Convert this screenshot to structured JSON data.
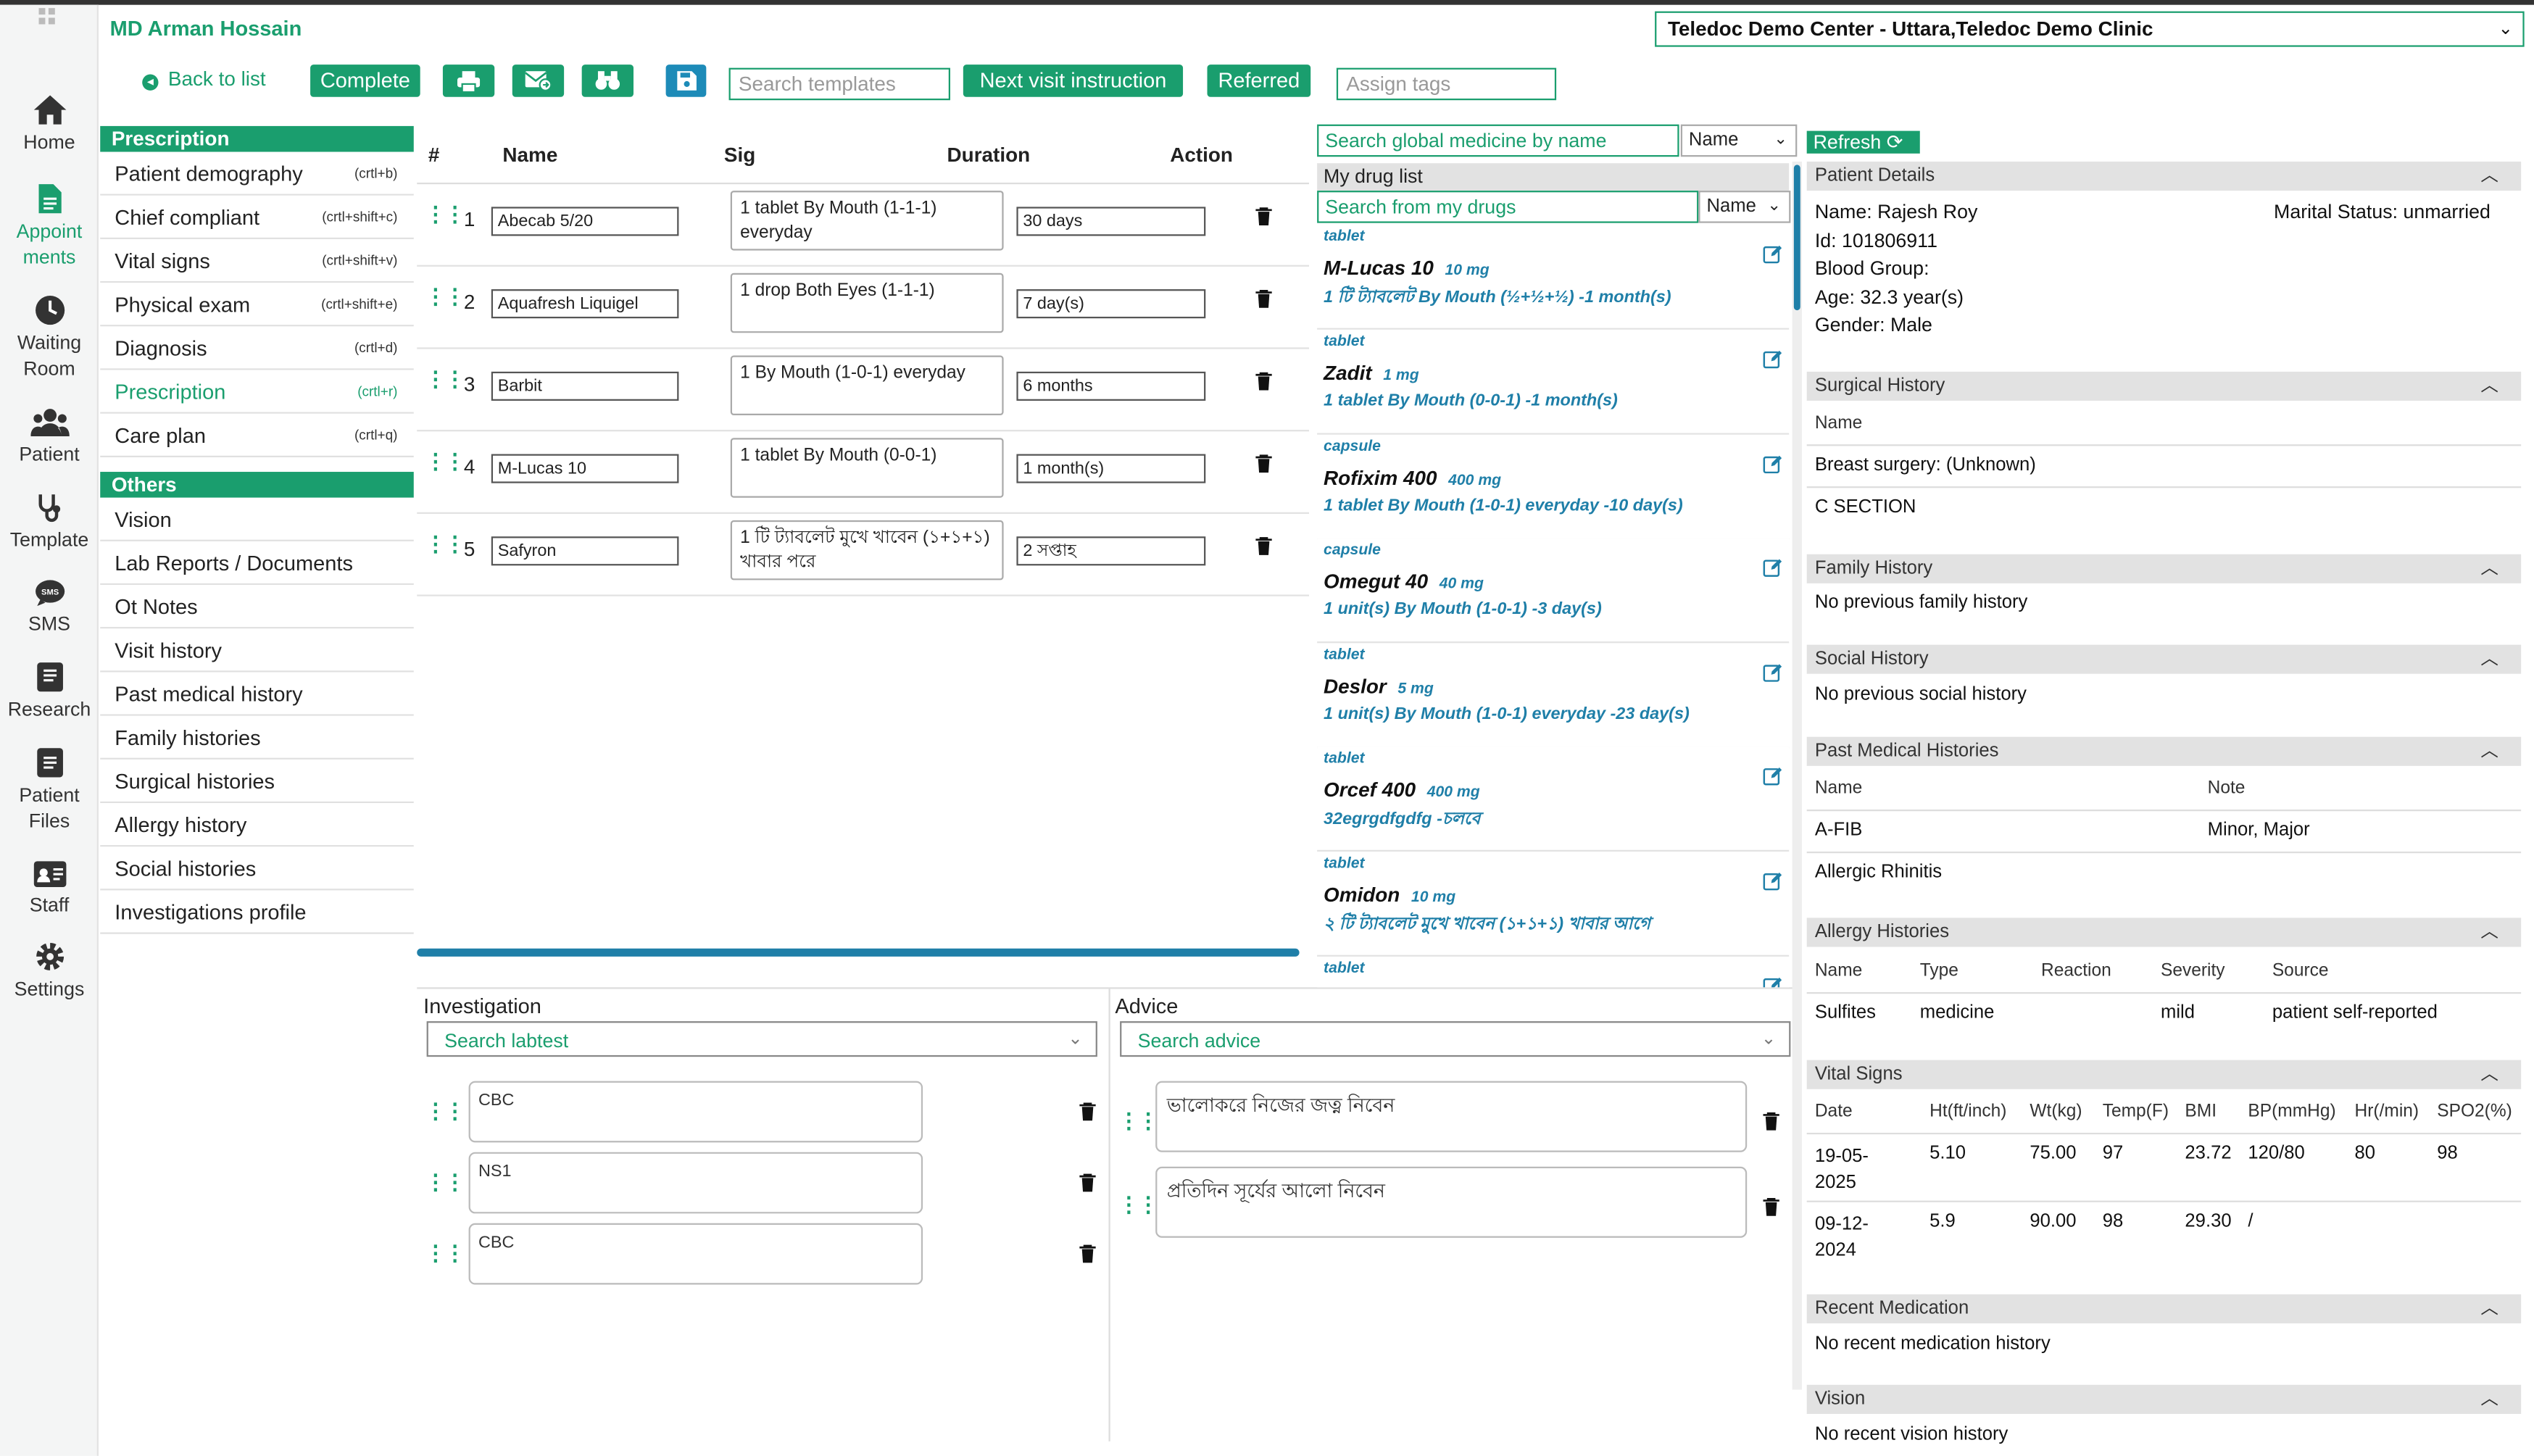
{
  "header": {
    "user_name": "MD Arman Hossain",
    "center": "Teledoc Demo Center - Uttara,Teledoc Demo Clinic"
  },
  "nav": {
    "home": "Home",
    "appointments_1": "Appoint",
    "appointments_2": "ments",
    "waiting_1": "Waiting",
    "waiting_2": "Room",
    "patient": "Patient",
    "template": "Template",
    "sms": "SMS",
    "research": "Research",
    "patient_files_1": "Patient",
    "patient_files_2": "Files",
    "staff": "Staff",
    "settings": "Settings"
  },
  "toolbar": {
    "back": "Back to list",
    "complete": "Complete",
    "search_templates_placeholder": "Search templates",
    "next_visit": "Next visit instruction",
    "referred": "Referred",
    "assign_tags_placeholder": "Assign tags"
  },
  "menu": {
    "prescription_head": "Prescription",
    "items": [
      {
        "label": "Patient demography",
        "shortcut": "(crtl+b)"
      },
      {
        "label": "Chief compliant",
        "shortcut": "(crtl+shift+c)"
      },
      {
        "label": "Vital signs",
        "shortcut": "(crtl+shift+v)"
      },
      {
        "label": "Physical exam",
        "shortcut": "(crtl+shift+e)"
      },
      {
        "label": "Diagnosis",
        "shortcut": "(crtl+d)"
      },
      {
        "label": "Prescription",
        "shortcut": "(crtl+r)"
      },
      {
        "label": "Care plan",
        "shortcut": "(crtl+q)"
      }
    ],
    "others_head": "Others",
    "others": [
      "Vision",
      "Lab Reports / Documents",
      "Ot Notes",
      "Visit history",
      "Past medical history",
      "Family histories",
      "Surgical histories",
      "Allergy history",
      "Social histories",
      "Investigations profile"
    ]
  },
  "rx_table": {
    "headers": {
      "num": "#",
      "name": "Name",
      "sig": "Sig",
      "duration": "Duration",
      "action": "Action"
    },
    "rows": [
      {
        "num": "1",
        "name": "Abecab 5/20",
        "sig": "1 tablet By Mouth (1-1-1) everyday",
        "duration": "30 days"
      },
      {
        "num": "2",
        "name": "Aquafresh Liquigel",
        "sig": "1 drop Both Eyes (1-1-1)",
        "duration": "7 day(s)"
      },
      {
        "num": "3",
        "name": "Barbit",
        "sig": "1  By Mouth (1-0-1) everyday",
        "duration": "6 months"
      },
      {
        "num": "4",
        "name": "M-Lucas 10",
        "sig": "1 tablet By Mouth (0-0-1)",
        "duration": "1 month(s)"
      },
      {
        "num": "5",
        "name": "Safyron",
        "sig": "1 টি ট্যাবলেট মুখে খাবেন (১+১+১) খাবার পরে",
        "duration": "2 সপ্তাহ"
      }
    ]
  },
  "investigation": {
    "label": "Investigation",
    "placeholder": "Search labtest",
    "items": [
      "CBC",
      "NS1",
      "CBC"
    ]
  },
  "advice": {
    "label": "Advice",
    "placeholder": "Search advice",
    "items": [
      "ভালোকরে নিজের জত্ন নিবেন",
      "প্রতিদিন সূর্যের আলো নিবেন"
    ]
  },
  "drug_list": {
    "global_search_placeholder": "Search global medicine by name",
    "sort": "Name",
    "title": "My drug list",
    "my_search_placeholder": "Search from my drugs",
    "drugs": [
      {
        "form": "tablet",
        "name": "M-Lucas 10",
        "strength": "10 mg",
        "sig": "1 টি ট্যাবলেট By Mouth (½+½+½) -1 month(s)"
      },
      {
        "form": "tablet",
        "name": "Zadit",
        "strength": "1 mg",
        "sig": "1 tablet By Mouth (0-0-1) -1 month(s)"
      },
      {
        "form": "capsule",
        "name": "Rofixim 400",
        "strength": "400 mg",
        "sig": "1 tablet By Mouth (1-0-1) everyday -10 day(s)"
      },
      {
        "form": "capsule",
        "name": "Omegut 40",
        "strength": "40 mg",
        "sig": "1 unit(s) By Mouth (1-0-1) -3 day(s)"
      },
      {
        "form": "tablet",
        "name": "Deslor",
        "strength": "5 mg",
        "sig": "1 unit(s) By Mouth (1-0-1) everyday -23 day(s)"
      },
      {
        "form": "tablet",
        "name": "Orcef 400",
        "strength": "400 mg",
        "sig": "32egrgdfgdfg -চলবে"
      },
      {
        "form": "tablet",
        "name": "Omidon",
        "strength": "10 mg",
        "sig": "২ টি ট্যাবলেট মুখে খাবেন (১+১+১) খাবার আগে"
      },
      {
        "form": "tablet",
        "name": "",
        "strength": "",
        "sig": ""
      }
    ]
  },
  "patient": {
    "refresh": "Refresh",
    "details_title": "Patient Details",
    "name": "Name: Rajesh Roy",
    "marital": "Marital Status: unmarried",
    "id": "Id: 101806911",
    "blood": "Blood Group:",
    "age": "Age: 32.3 year(s)",
    "gender": "Gender: Male",
    "surgical_title": "Surgical History",
    "surgical_col": "Name",
    "surgical_items": [
      "Breast surgery: (Unknown)",
      "C SECTION"
    ],
    "family_title": "Family History",
    "family_text": "No previous family history",
    "social_title": "Social History",
    "social_text": "No previous social history",
    "pmh_title": "Past Medical Histories",
    "pmh_cols": [
      "Name",
      "Note"
    ],
    "pmh_rows": [
      [
        "A-FIB",
        "Minor, Major"
      ],
      [
        "Allergic Rhinitis",
        ""
      ]
    ],
    "allergy_title": "Allergy Histories",
    "allergy_cols": [
      "Name",
      "Type",
      "Reaction",
      "Severity",
      "Source"
    ],
    "allergy_rows": [
      [
        "Sulfites",
        "medicine",
        "",
        "mild",
        "patient self-reported"
      ]
    ],
    "vitals_title": "Vital Signs",
    "vitals_cols": [
      "Date",
      "Ht(ft/inch)",
      "Wt(kg)",
      "Temp(F)",
      "BMI",
      "BP(mmHg)",
      "Hr(/min)",
      "SPO2(%)"
    ],
    "vitals_rows": [
      {
        "date1": "19-05-",
        "date2": "2025",
        "ht": "5.10",
        "wt": "75.00",
        "temp": "97",
        "bmi": "23.72",
        "bp": "120/80",
        "hr": "80",
        "spo2": "98"
      },
      {
        "date1": "09-12-",
        "date2": "2024",
        "ht": "5.9",
        "wt": "90.00",
        "temp": "98",
        "bmi": "29.30",
        "bp": "/",
        "hr": "",
        "spo2": ""
      }
    ],
    "recent_med_title": "Recent Medication",
    "recent_med_text": "No recent medication history",
    "vision_title": "Vision",
    "vision_text": "No recent vision history"
  }
}
